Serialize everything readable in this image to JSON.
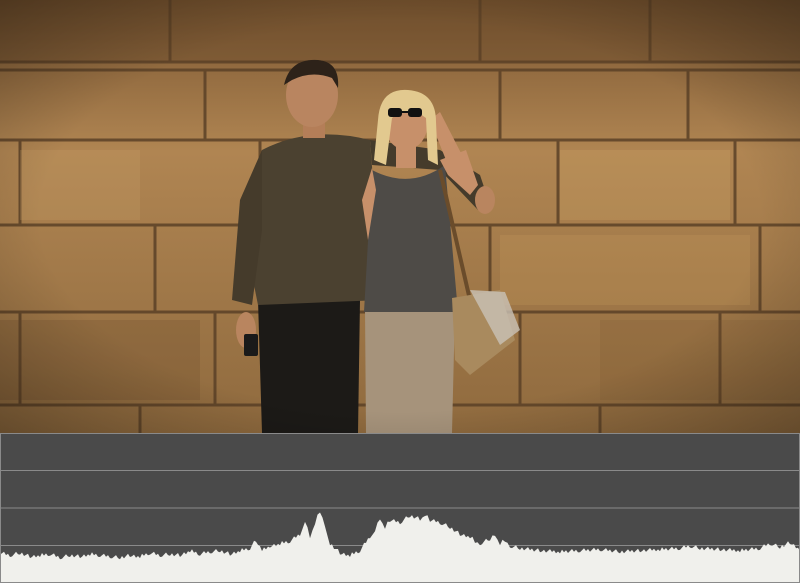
{
  "video_frame": {
    "scene": "couple-against-stone-wall",
    "colors": {
      "stone_light": "#c79a5a",
      "stone_mid": "#a47a44",
      "stone_dark": "#6e4f2c",
      "mortar": "#5b4127",
      "shirt": "#4b4130",
      "tank_top": "#4e4b47",
      "trousers_her": "#a6937b",
      "trousers_him": "#1c1a17",
      "skin": "#c7906a",
      "hair_blonde": "#e2c98f",
      "hair_dark": "#2d2219",
      "bag": "#a98a5e"
    }
  },
  "histogram": {
    "colors": {
      "background": "#4a4a4a",
      "fill": "#f0f0ec",
      "gridline": "#8a8a8a"
    },
    "chart_data": {
      "type": "area",
      "x": [
        0,
        10,
        20,
        30,
        40,
        50,
        60,
        70,
        80,
        90,
        100,
        110,
        120,
        130,
        140,
        150,
        160,
        170,
        180,
        190,
        200,
        210,
        220,
        230,
        240,
        250,
        256,
        262,
        270,
        280,
        290,
        300,
        305,
        310,
        315,
        320,
        325,
        330,
        340,
        350,
        360,
        370,
        375,
        380,
        385,
        390,
        400,
        410,
        420,
        425,
        430,
        440,
        450,
        460,
        470,
        475,
        480,
        490,
        495,
        500,
        505,
        510,
        520,
        540,
        560,
        580,
        600,
        620,
        640,
        660,
        680,
        690,
        700,
        720,
        740,
        760,
        770,
        780,
        790,
        800
      ],
      "values": [
        0.14,
        0.12,
        0.14,
        0.11,
        0.12,
        0.13,
        0.1,
        0.12,
        0.11,
        0.13,
        0.12,
        0.11,
        0.1,
        0.12,
        0.11,
        0.14,
        0.12,
        0.13,
        0.12,
        0.16,
        0.13,
        0.15,
        0.16,
        0.13,
        0.16,
        0.18,
        0.25,
        0.17,
        0.2,
        0.22,
        0.24,
        0.3,
        0.42,
        0.28,
        0.4,
        0.5,
        0.38,
        0.22,
        0.14,
        0.12,
        0.16,
        0.28,
        0.34,
        0.44,
        0.36,
        0.42,
        0.4,
        0.46,
        0.43,
        0.47,
        0.42,
        0.4,
        0.36,
        0.3,
        0.28,
        0.24,
        0.22,
        0.26,
        0.3,
        0.22,
        0.25,
        0.2,
        0.18,
        0.16,
        0.15,
        0.16,
        0.17,
        0.15,
        0.16,
        0.17,
        0.18,
        0.2,
        0.18,
        0.17,
        0.16,
        0.18,
        0.22,
        0.19,
        0.23,
        0.17
      ],
      "ylim": [
        0,
        1
      ],
      "grid": true
    }
  }
}
